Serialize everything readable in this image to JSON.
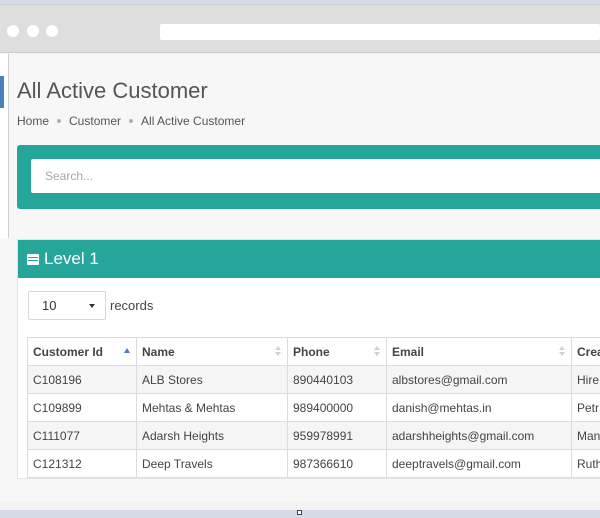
{
  "page": {
    "title": "All Active Customer",
    "breadcrumb": [
      "Home",
      "Customer",
      "All Active Customer"
    ]
  },
  "search": {
    "placeholder": "Search...",
    "value": ""
  },
  "panel": {
    "title": "Level 1"
  },
  "table_controls": {
    "page_length": "10",
    "records_label": "records"
  },
  "table": {
    "columns": [
      "Customer Id",
      "Name",
      "Phone",
      "Email",
      "Crea"
    ],
    "sorted_column": "Customer Id",
    "sort_direction": "ascending",
    "rows": [
      [
        "C108196",
        "ALB Stores",
        "890440103",
        "albstores@gmail.com",
        "Hire"
      ],
      [
        "C109899",
        "Mehtas & Mehtas",
        "989400000",
        "danish@mehtas.in",
        "Petr"
      ],
      [
        "C111077",
        "Adarsh Heights",
        "959978991",
        "adarshheights@gmail.com",
        "Man"
      ],
      [
        "C121312",
        "Deep Travels",
        "987366610",
        "deeptravels@gmail.com",
        "Ruth"
      ]
    ]
  },
  "colors": {
    "accent_teal": "#26a69a",
    "sidebar_active": "#4a7fc1",
    "sort_indicator": "#4a7fc1"
  },
  "icons": {
    "panel_icon": "table-icon",
    "length_select": "caret-down-icon"
  }
}
